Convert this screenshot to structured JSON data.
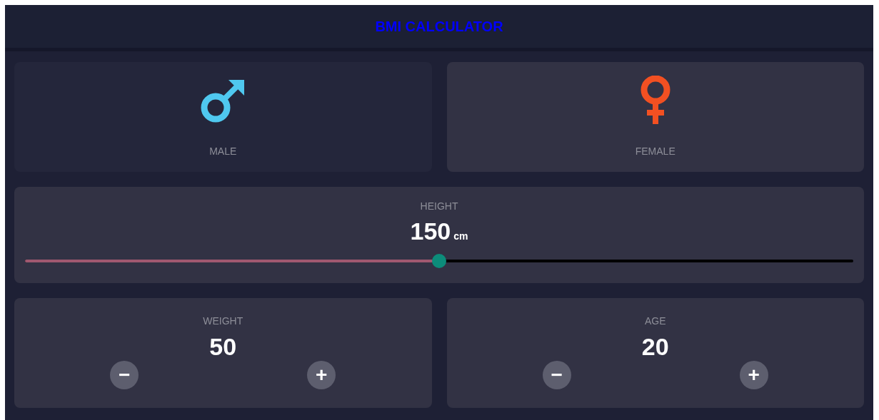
{
  "header": {
    "title": "BMI CALCULATOR"
  },
  "genders": [
    {
      "kind": "male",
      "label": "MALE",
      "selected": true
    },
    {
      "kind": "female",
      "label": "FEMALE",
      "selected": false
    }
  ],
  "height": {
    "label": "HEIGHT",
    "value": "150",
    "unit": "cm",
    "level": 0.5
  },
  "counters": [
    {
      "label": "WEIGHT",
      "value": "50",
      "minus": "−",
      "plus": "+"
    },
    {
      "label": "AGE",
      "value": "20",
      "minus": "−",
      "plus": "+"
    }
  ]
}
